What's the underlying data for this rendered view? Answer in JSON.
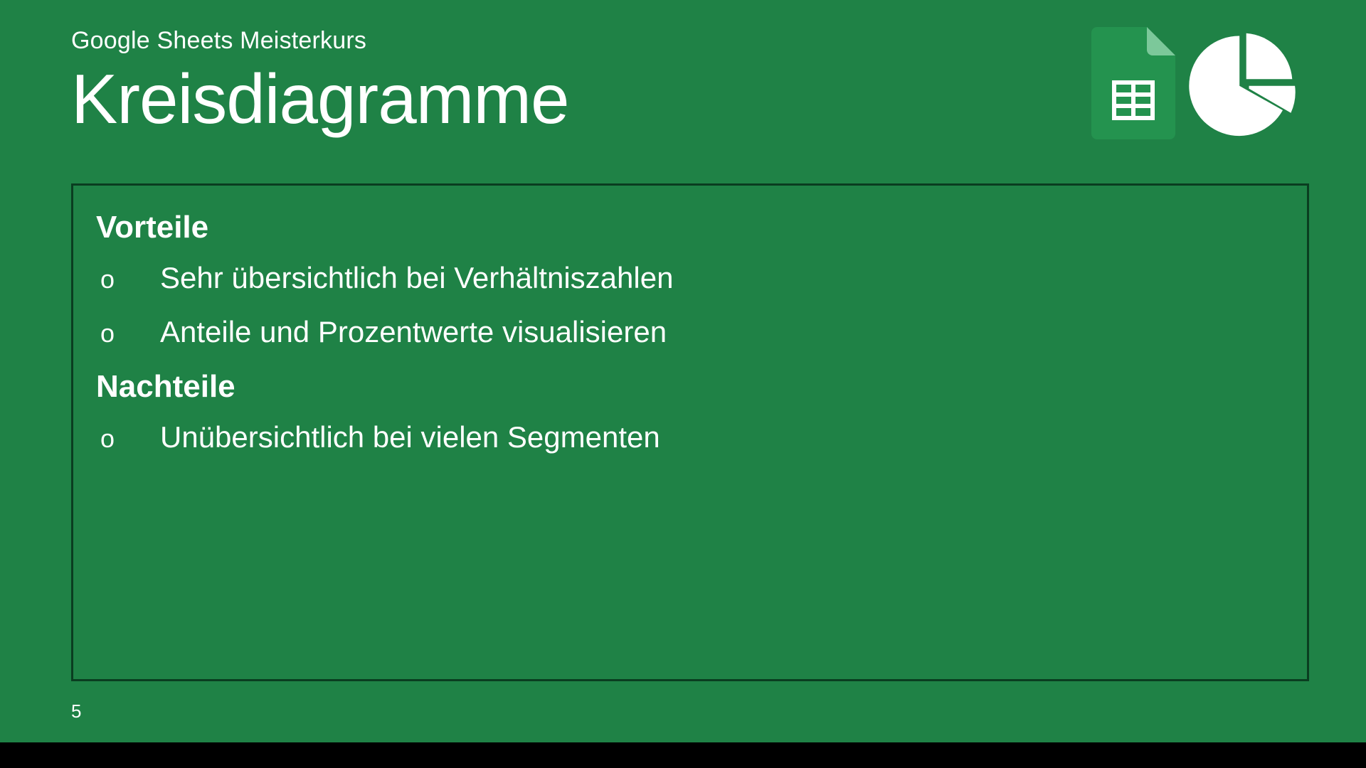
{
  "header": {
    "subtitle": "Google Sheets Meisterkurs",
    "title": "Kreisdiagramme"
  },
  "content": {
    "section1_heading": "Vorteile",
    "section1_items": [
      "Sehr übersichtlich bei Verhältniszahlen",
      "Anteile und Prozentwerte visualisieren"
    ],
    "section2_heading": "Nachteile",
    "section2_items": [
      "Unübersichtlich bei vielen Segmenten"
    ]
  },
  "page_number": "5",
  "icons": {
    "sheets": "google-sheets-icon",
    "pie": "pie-chart-icon"
  },
  "colors": {
    "background": "#1f8246",
    "border": "#0a3d20",
    "text": "#ffffff",
    "sheets_green": "#2fa85a"
  }
}
